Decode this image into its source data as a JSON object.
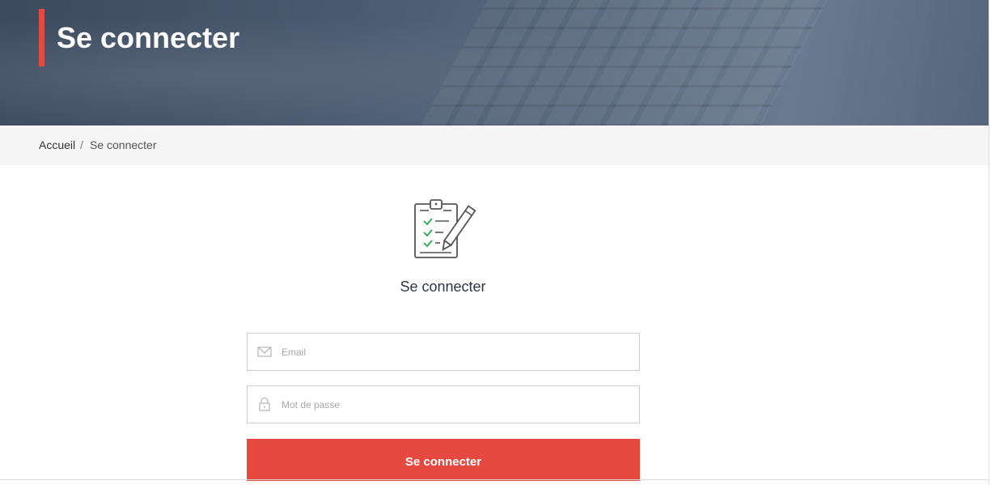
{
  "hero": {
    "title": "Se connecter"
  },
  "breadcrumb": {
    "home": "Accueil",
    "separator": "/",
    "current": "Se connecter"
  },
  "form": {
    "icon": "clipboard-checklist-pencil-icon",
    "title": "Se connecter",
    "email": {
      "icon": "envelope-icon",
      "placeholder": "Email",
      "value": ""
    },
    "password": {
      "icon": "lock-icon",
      "placeholder": "Mot de passe",
      "value": ""
    },
    "submit_label": "Se connecter"
  },
  "colors": {
    "accent": "#e24b41",
    "button": "#e5493f",
    "check": "#2ea84f",
    "hero_overlay": "#3c4a5e",
    "breadcrumb_bg": "#f5f5f5"
  }
}
